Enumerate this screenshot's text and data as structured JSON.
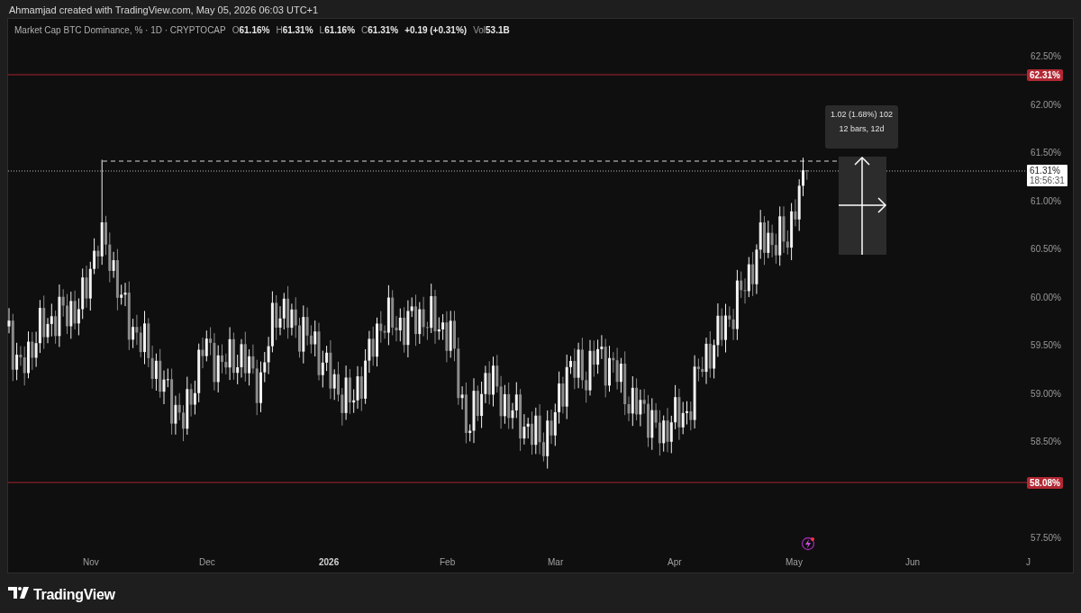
{
  "header": {
    "title": "Ahmamjad created with TradingView.com, May 05, 2026 06:03 UTC+1"
  },
  "legend": {
    "symbol": "Market Cap BTC Dominance, % · 1D · CRYPTOCAP",
    "ohlc": [
      {
        "label": "O",
        "value": "61.16%"
      },
      {
        "label": "H",
        "value": "61.31%"
      },
      {
        "label": "L",
        "value": "61.16%"
      },
      {
        "label": "C",
        "value": "61.31%"
      }
    ],
    "change": "+0.19 (+0.31%)",
    "volume": {
      "label": "Vol",
      "value": "53.1B"
    }
  },
  "price_axis": {
    "ticks": [
      "62.50%",
      "62.00%",
      "61.50%",
      "61.00%",
      "60.50%",
      "60.00%",
      "59.50%",
      "59.00%",
      "58.50%",
      "57.50%"
    ]
  },
  "price_labels": [
    {
      "kind": "level",
      "text": "62.31%"
    },
    {
      "kind": "current",
      "text": "61.31%",
      "countdown": "18:56:31"
    },
    {
      "kind": "level",
      "text": "58.08%"
    }
  ],
  "time_axis": {
    "labels": [
      "Nov",
      "Dec",
      "2026",
      "Feb",
      "Mar",
      "Apr",
      "May",
      "Jun",
      "J"
    ]
  },
  "measure": {
    "change": "1.02 (1.68%) 102",
    "span": "12 bars, 12d"
  },
  "footer": {
    "brand": "TradingView"
  }
}
